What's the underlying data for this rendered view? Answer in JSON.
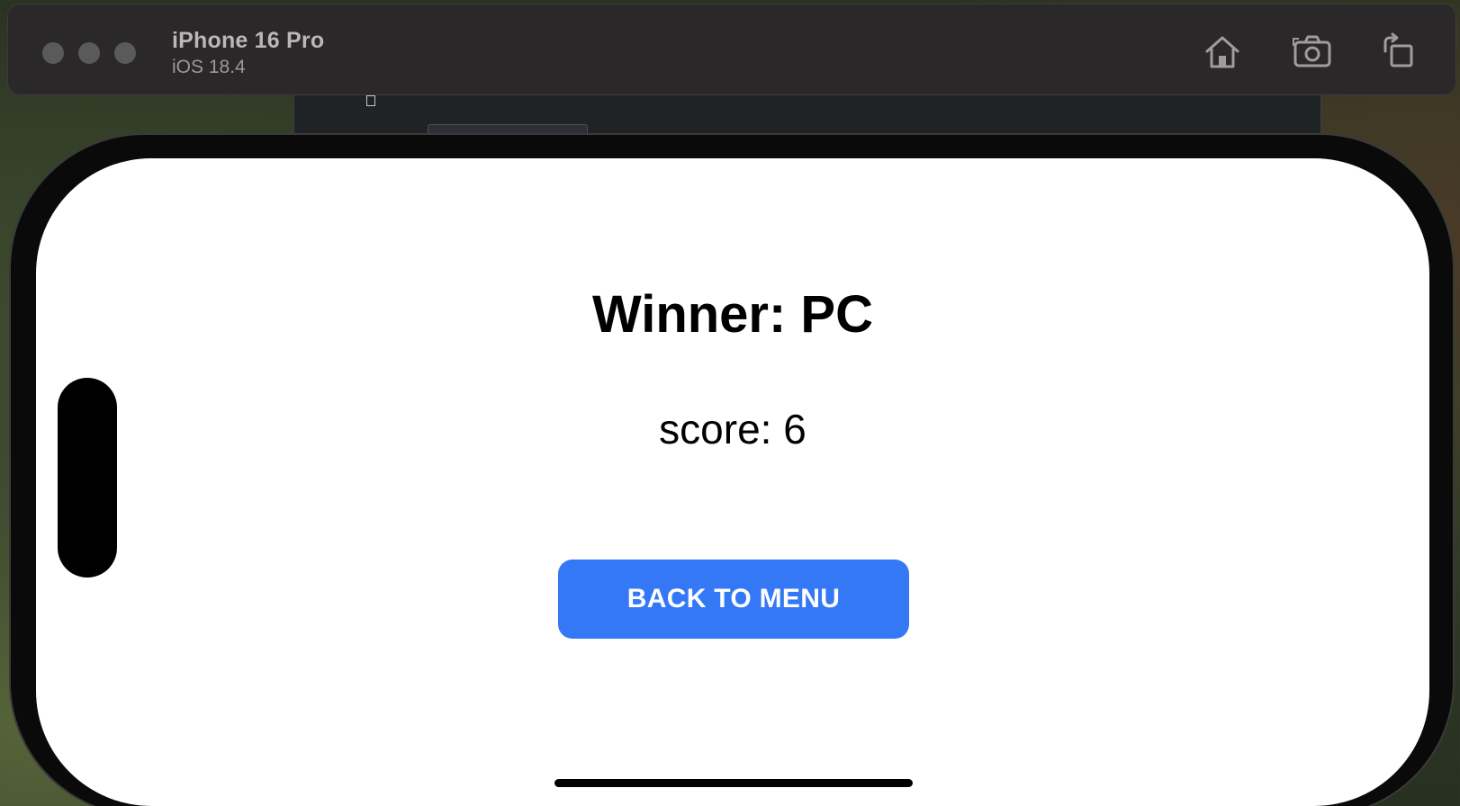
{
  "simulator": {
    "device_name": "iPhone 16 Pro",
    "os_version": "iOS 18.4",
    "icons": [
      "home-icon",
      "screenshot-camera-icon",
      "rotate-icon"
    ]
  },
  "app": {
    "winner_label": "Winner: PC",
    "score_label": "score: 6",
    "back_button_label": "BACK TO MENU"
  },
  "colors": {
    "button": "#3478f6",
    "button_text": "#ffffff",
    "screen_background": "#ffffff",
    "title_bar": "#2a2828"
  }
}
